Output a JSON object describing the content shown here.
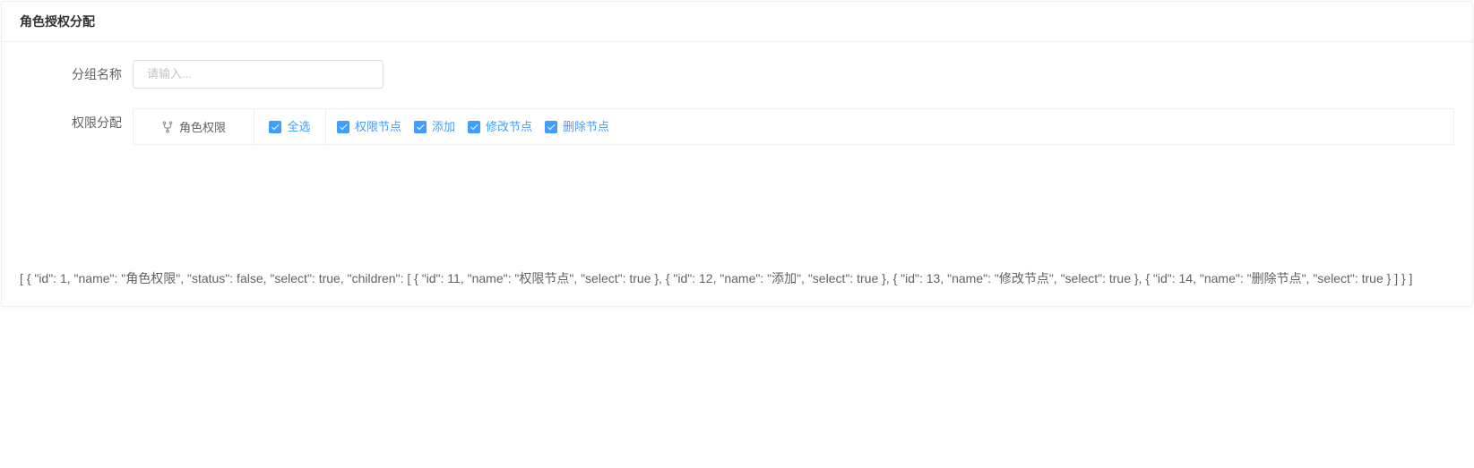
{
  "header": {
    "title": "角色授权分配"
  },
  "form": {
    "groupName": {
      "label": "分组名称",
      "placeholder": "请输入...",
      "value": ""
    },
    "permAssign": {
      "label": "权限分配",
      "root": {
        "name": "角色权限",
        "selectAllLabel": "全选",
        "selectAllChecked": true,
        "children": [
          {
            "name": "权限节点",
            "checked": true
          },
          {
            "name": "添加",
            "checked": true
          },
          {
            "name": "修改节点",
            "checked": true
          },
          {
            "name": "删除节点",
            "checked": true
          }
        ]
      }
    }
  },
  "debug": "[ { \"id\": 1, \"name\": \"角色权限\", \"status\": false, \"select\": true, \"children\": [ { \"id\": 11, \"name\": \"权限节点\", \"select\": true }, { \"id\": 12, \"name\": \"添加\", \"select\": true }, { \"id\": 13, \"name\": \"修改节点\", \"select\": true }, { \"id\": 14, \"name\": \"删除节点\", \"select\": true } ] } ]"
}
